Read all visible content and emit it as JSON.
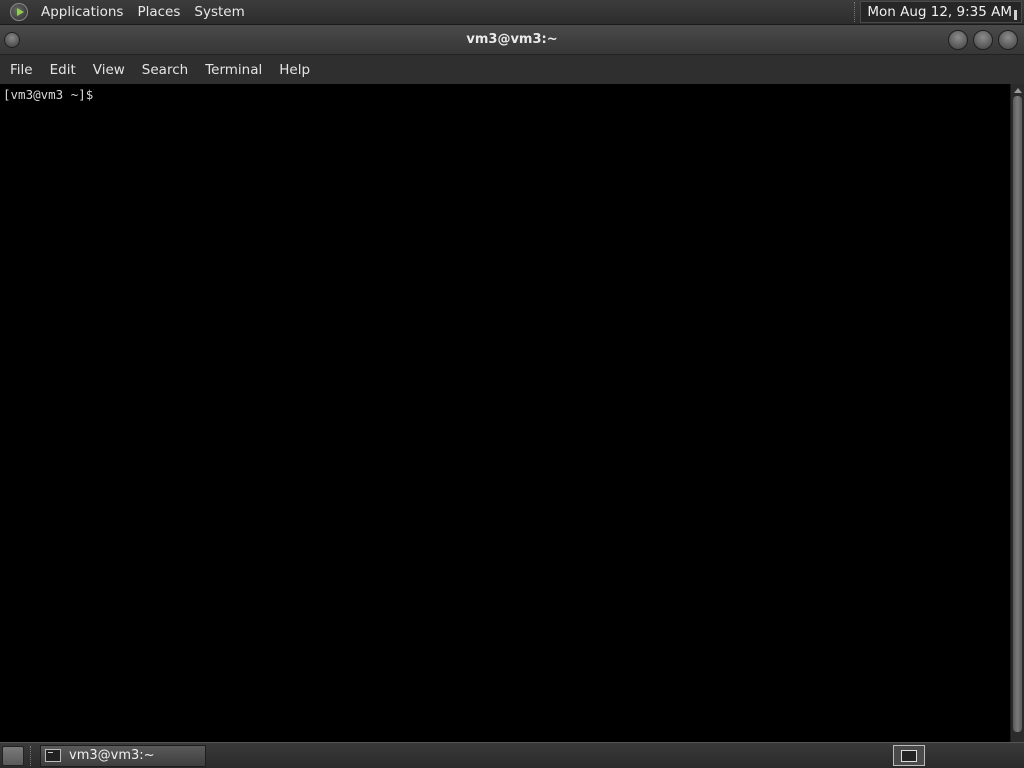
{
  "top_panel": {
    "menus": [
      "Applications",
      "Places",
      "System"
    ],
    "clock": "Mon Aug 12,  9:35 AM"
  },
  "window": {
    "title": "vm3@vm3:~"
  },
  "menubar": {
    "items": [
      "File",
      "Edit",
      "View",
      "Search",
      "Terminal",
      "Help"
    ]
  },
  "terminal": {
    "prompt": "[vm3@vm3 ~]$"
  },
  "bottom_panel": {
    "tasks": [
      {
        "label": "vm3@vm3:~",
        "icon": "terminal-icon"
      }
    ]
  },
  "colors": {
    "terminal_bg": "#000000",
    "panel_bg": "#2f2f2f",
    "logo_accent": "#8fce4f"
  }
}
